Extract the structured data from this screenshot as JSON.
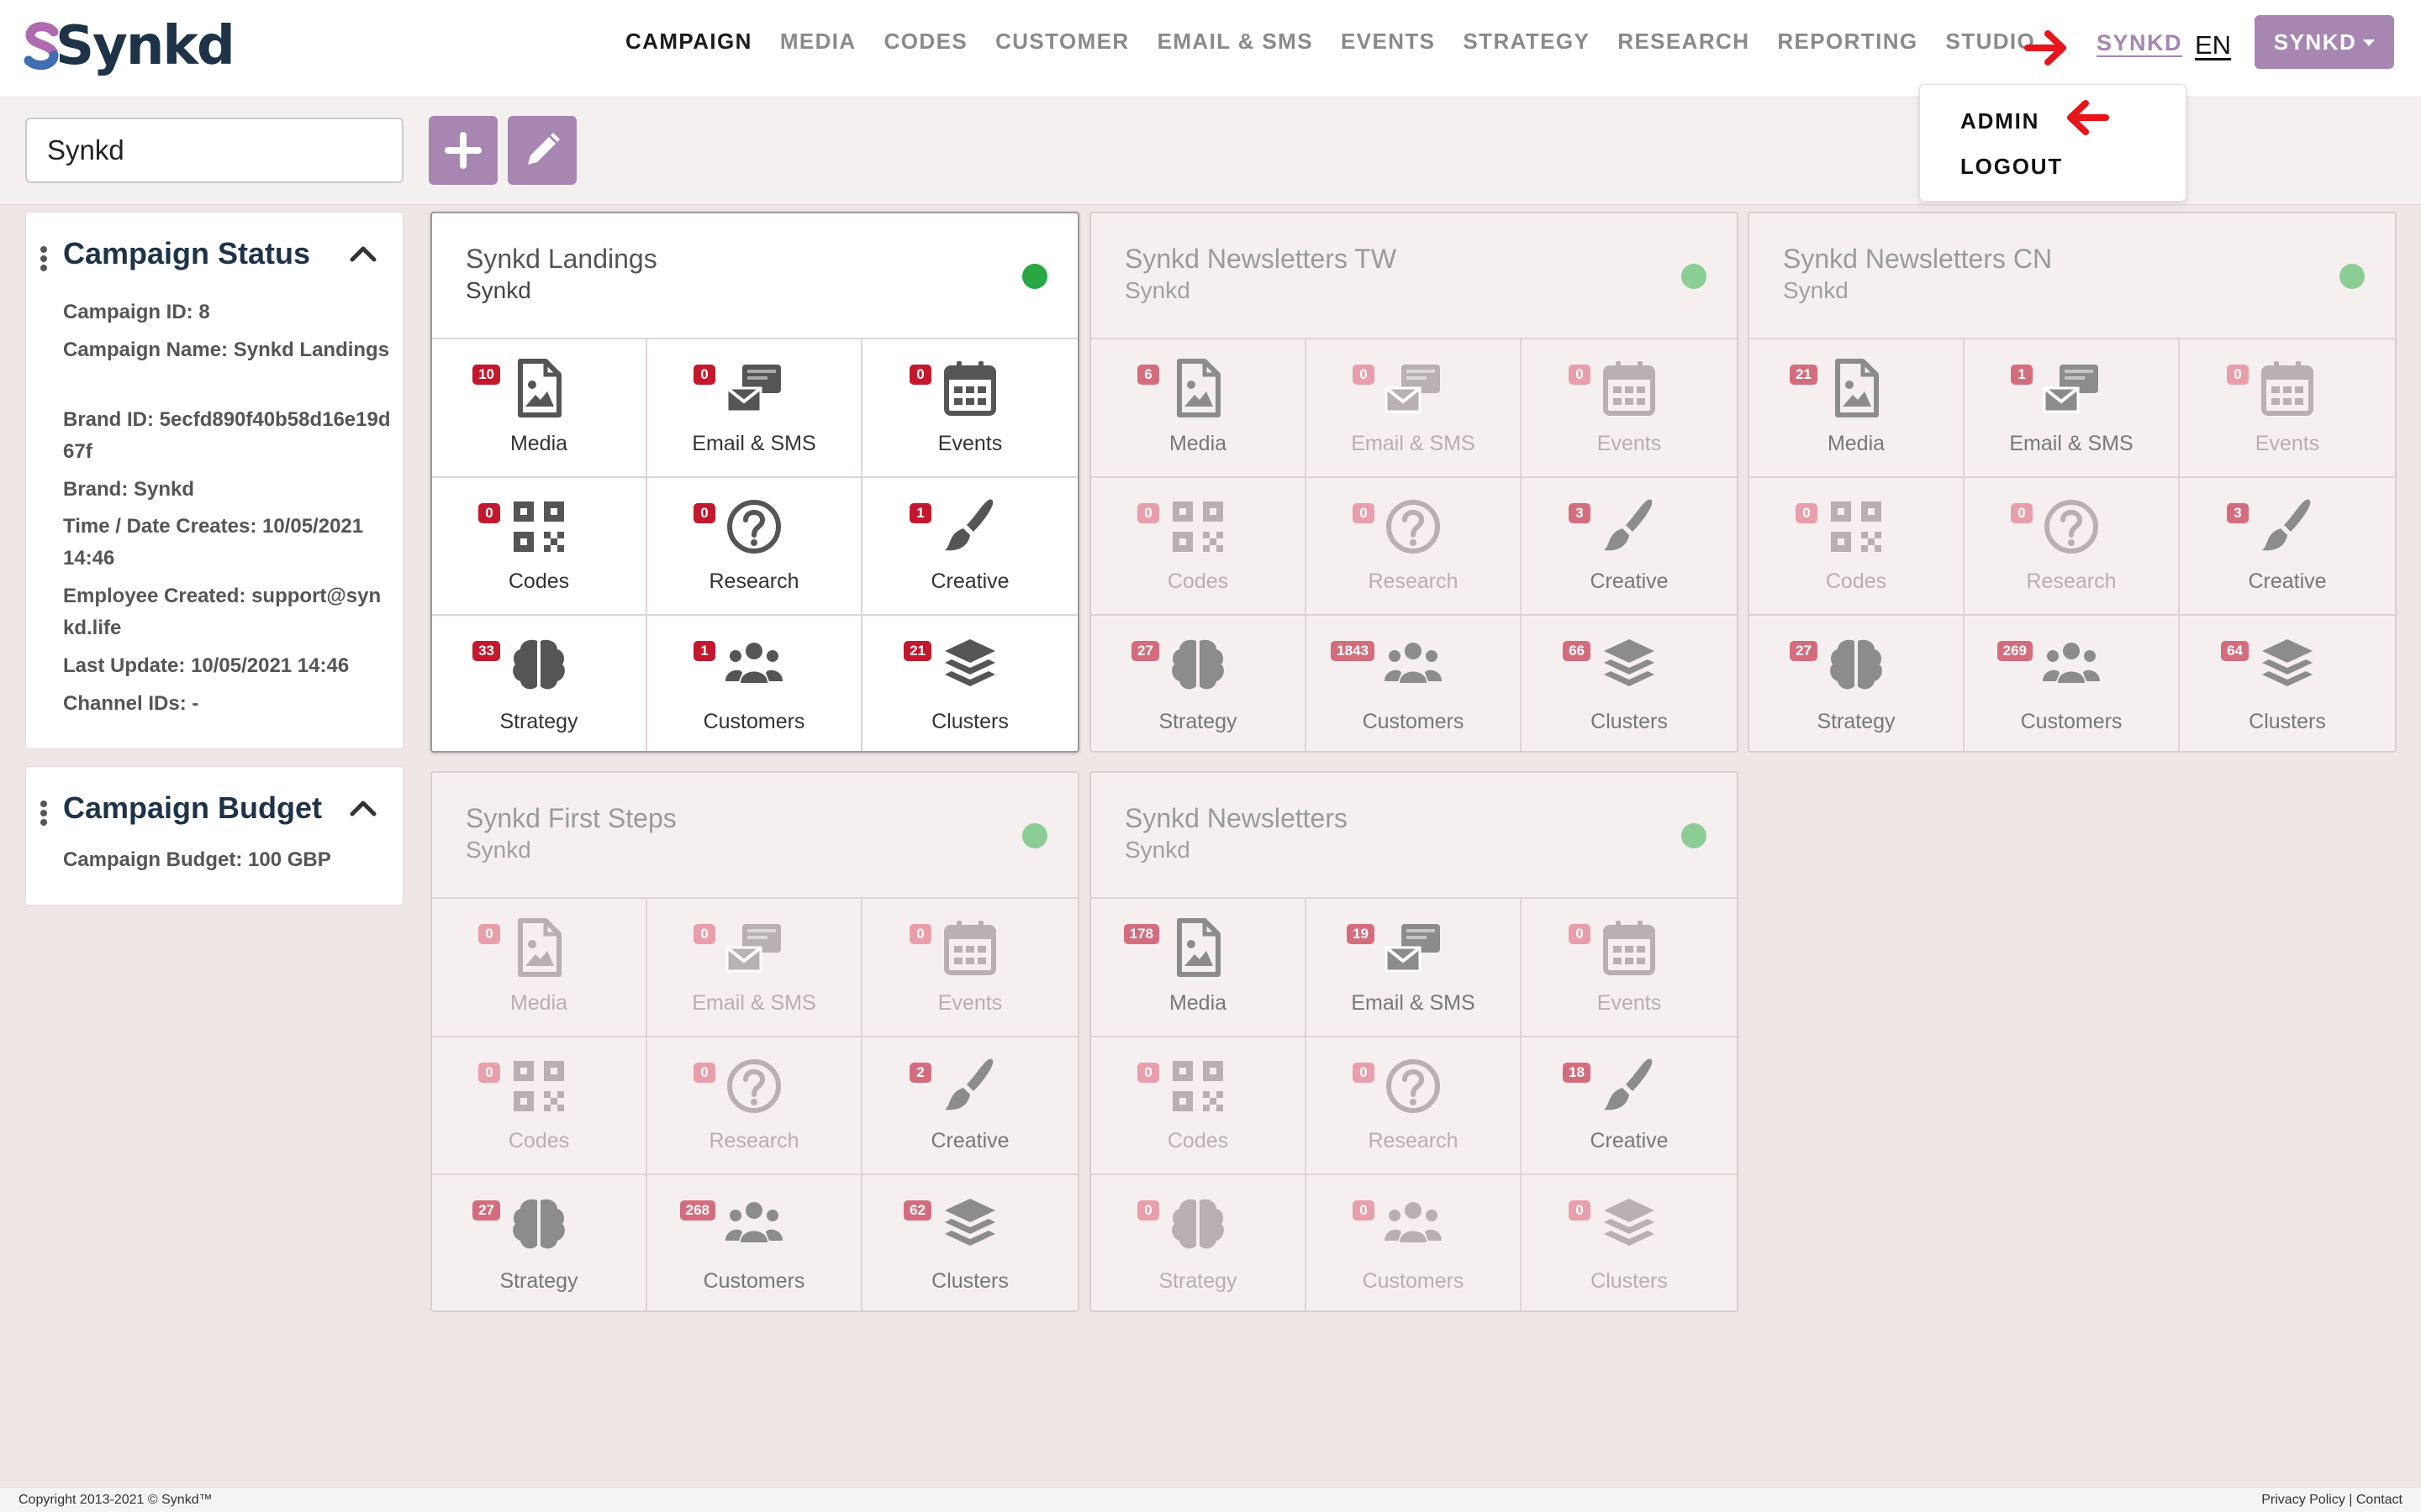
{
  "brand": {
    "logo_text": "Synkd"
  },
  "nav": [
    "CAMPAIGN",
    "MEDIA",
    "CODES",
    "CUSTOMER",
    "EMAIL & SMS",
    "EVENTS",
    "STRATEGY",
    "RESEARCH",
    "REPORTING",
    "STUDIO"
  ],
  "header": {
    "user_link": "SYNKD",
    "language": "EN",
    "user_button": "SYNKD"
  },
  "user_menu": {
    "items": [
      "ADMIN",
      "LOGOUT"
    ]
  },
  "toolbar": {
    "search_value": "Synkd"
  },
  "status_panel": {
    "title": "Campaign Status",
    "lines": [
      "Campaign ID: 8",
      "Campaign Name: Synkd Landings",
      "Brand ID: 5ecfd890f40b58d16e19d67f",
      "Brand: Synkd",
      "Time / Date Creates: 10/05/2021 14:46",
      "Employee Created: support@synkd.life",
      "Last Update: 10/05/2021 14:46",
      "Channel IDs: -"
    ]
  },
  "budget_panel": {
    "title": "Campaign Budget",
    "line": "Campaign Budget: 100 GBP"
  },
  "tile_labels": [
    "Media",
    "Email & SMS",
    "Events",
    "Codes",
    "Research",
    "Creative",
    "Strategy",
    "Customers",
    "Clusters"
  ],
  "tile_icons": [
    "image-file-icon",
    "email-sms-icon",
    "calendar-icon",
    "qr-code-icon",
    "question-circle-icon",
    "paintbrush-icon",
    "brain-icon",
    "users-icon",
    "layers-icon"
  ],
  "campaigns": [
    {
      "title": "Synkd Landings",
      "brand": "Synkd",
      "active": true,
      "counts": [
        10,
        0,
        0,
        0,
        0,
        1,
        33,
        1,
        21
      ]
    },
    {
      "title": "Synkd Newsletters TW",
      "brand": "Synkd",
      "active": false,
      "counts": [
        6,
        0,
        0,
        0,
        0,
        3,
        27,
        1843,
        66
      ]
    },
    {
      "title": "Synkd Newsletters CN",
      "brand": "Synkd",
      "active": false,
      "counts": [
        21,
        1,
        0,
        0,
        0,
        3,
        27,
        269,
        64
      ]
    },
    {
      "title": "Synkd First Steps",
      "brand": "Synkd",
      "active": false,
      "counts": [
        0,
        0,
        0,
        0,
        0,
        2,
        27,
        268,
        62
      ]
    },
    {
      "title": "Synkd Newsletters",
      "brand": "Synkd",
      "active": false,
      "counts": [
        178,
        19,
        0,
        0,
        0,
        18,
        0,
        0,
        0
      ]
    }
  ],
  "colors": {
    "accent": "#a786b1",
    "badge_active": "#c3182e",
    "status_green": "#28a745",
    "arrow_red": "#e8141b"
  },
  "footer": {
    "copyright": "Copyright 2013-2021 © Synkd™",
    "links": "Privacy Policy | Contact"
  }
}
